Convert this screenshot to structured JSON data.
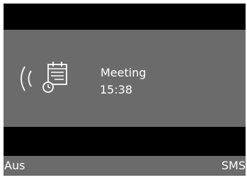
{
  "colors": {
    "bar": "#000000",
    "panel": "#6b6b6b",
    "text": "#ffffff"
  },
  "notification": {
    "icons": [
      "ring-indicator-icon",
      "calendar-clock-icon"
    ],
    "title": "Meeting",
    "time": "15:38"
  },
  "softkeys": {
    "left_label": "Aus",
    "right_label": "SMS"
  }
}
